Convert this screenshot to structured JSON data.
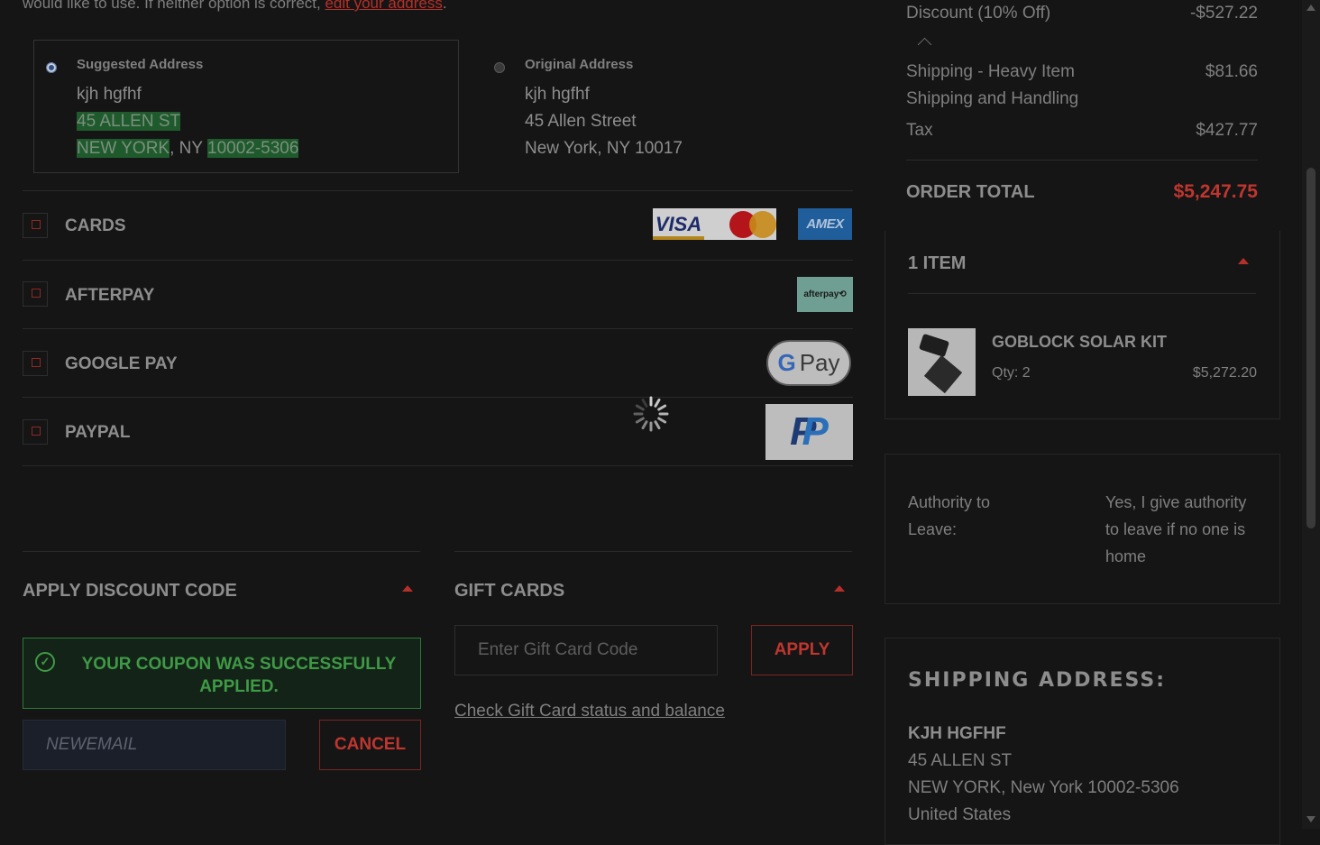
{
  "address": {
    "note_text": "would like to use. If neither option is correct, ",
    "edit_link": "edit your address",
    "note_end": ".",
    "suggested": {
      "heading": "Suggested Address",
      "name": "kjh hgfhf",
      "street": "45 ALLEN ST",
      "city": "NEW YORK",
      "state_sep": ", NY ",
      "zip": "10002-5306"
    },
    "original": {
      "heading": "Original Address",
      "name": "kjh hgfhf",
      "street": "45 Allen Street",
      "city_line": "New York, NY 10017"
    }
  },
  "payment": {
    "options": [
      {
        "label": "CARDS"
      },
      {
        "label": "AFTERPAY"
      },
      {
        "label": "GOOGLE PAY"
      },
      {
        "label": "PAYPAL"
      }
    ],
    "logos": {
      "visa": "VISA",
      "amex": "AMEX",
      "afterpay": "afterpay⟲",
      "gpay_g": "G",
      "gpay_text": "Pay",
      "paypal": "P"
    }
  },
  "discount": {
    "title": "APPLY DISCOUNT CODE",
    "success_msg": "YOUR COUPON WAS SUCCESSFULLY APPLIED.",
    "code_value": "NEWEMAIL",
    "cancel_label": "CANCEL"
  },
  "gift": {
    "title": "GIFT CARDS",
    "placeholder": "Enter Gift Card Code",
    "apply_label": "APPLY",
    "check_link": "Check Gift Card status and balance"
  },
  "summary": {
    "discount_label": "Discount (10% Off)",
    "discount_value": "-$527.22",
    "shipping_label": "Shipping - Heavy Item",
    "shipping_sub": "Shipping and Handling",
    "shipping_value": "$81.66",
    "tax_label": "Tax",
    "tax_value": "$427.77",
    "total_label": "ORDER TOTAL",
    "total_value": "$5,247.75",
    "items_header": "1 ITEM",
    "item_name": "GOBLOCK SOLAR KIT",
    "item_qty": "Qty: 2",
    "item_price": "$5,272.20"
  },
  "authority": {
    "label": "Authority to Leave:",
    "value": "Yes, I give authority to leave if no one is home"
  },
  "shipping_address": {
    "title": "SHIPPING ADDRESS:",
    "name": "KJH HGFHF",
    "street": "45 ALLEN ST",
    "city": "NEW YORK, New York 10002-5306",
    "country": "United States"
  },
  "colors": {
    "accent_red": "#c0362f",
    "success_green": "#3e9a45",
    "background": "#151515"
  }
}
